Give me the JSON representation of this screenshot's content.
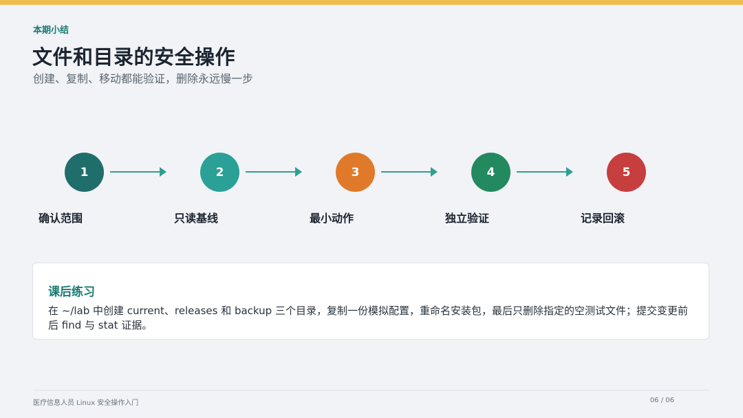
{
  "header": {
    "kicker": "本期小结",
    "title": "文件和目录的安全操作",
    "subtitle": "创建、复制、移动都能验证，删除永远慢一步"
  },
  "steps": [
    {
      "number": "1",
      "label": "确认范围",
      "color": "#1f6e6c"
    },
    {
      "number": "2",
      "label": "只读基线",
      "color": "#2aa096"
    },
    {
      "number": "3",
      "label": "最小动作",
      "color": "#e07a2a"
    },
    {
      "number": "4",
      "label": "独立验证",
      "color": "#23895e"
    },
    {
      "number": "5",
      "label": "记录回滚",
      "color": "#c73e3e"
    }
  ],
  "exercise": {
    "title": "课后练习",
    "body": "在 ~/lab 中创建 current、releases 和 backup 三个目录，复制一份模拟配置，重命名安装包，最后只删除指定的空测试文件；提交变更前后 find 与 stat 证据。"
  },
  "footer": {
    "left": "医疗信息人员 Linux 安全操作入门",
    "page": "06 / 06"
  }
}
